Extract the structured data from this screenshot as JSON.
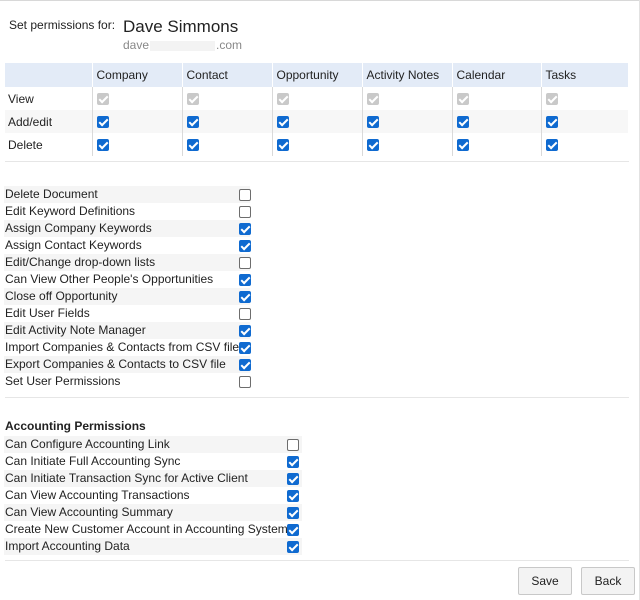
{
  "header": {
    "label": "Set permissions for:",
    "user_name": "Dave Simmons",
    "email_start": "dave",
    "email_end": ".com"
  },
  "object_permissions": {
    "columns": [
      "Company",
      "Contact",
      "Opportunity",
      "Activity Notes",
      "Calendar",
      "Tasks"
    ],
    "rows": [
      {
        "label": "View",
        "state": "disabled-checked",
        "values": [
          true,
          true,
          true,
          true,
          true,
          true
        ]
      },
      {
        "label": "Add/edit",
        "state": "enabled",
        "values": [
          true,
          true,
          true,
          true,
          true,
          true
        ]
      },
      {
        "label": "Delete",
        "state": "enabled",
        "values": [
          true,
          true,
          true,
          true,
          true,
          true
        ]
      }
    ]
  },
  "general_permissions": [
    {
      "label": "Delete Document",
      "checked": false
    },
    {
      "label": "Edit Keyword Definitions",
      "checked": false
    },
    {
      "label": "Assign Company Keywords",
      "checked": true
    },
    {
      "label": "Assign Contact Keywords",
      "checked": true
    },
    {
      "label": "Edit/Change drop-down lists",
      "checked": false
    },
    {
      "label": "Can View Other People's Opportunities",
      "checked": true
    },
    {
      "label": "Close off Opportunity",
      "checked": true
    },
    {
      "label": "Edit User Fields",
      "checked": false
    },
    {
      "label": "Edit Activity Note Manager",
      "checked": true
    },
    {
      "label": "Import Companies & Contacts from CSV file",
      "checked": true
    },
    {
      "label": "Export Companies & Contacts to CSV file",
      "checked": true
    },
    {
      "label": "Set User Permissions",
      "checked": false
    }
  ],
  "accounting": {
    "title": "Accounting Permissions",
    "items": [
      {
        "label": "Can Configure Accounting Link",
        "checked": false
      },
      {
        "label": "Can Initiate Full Accounting Sync",
        "checked": true
      },
      {
        "label": "Can Initiate Transaction Sync for Active Client",
        "checked": true
      },
      {
        "label": "Can View Accounting Transactions",
        "checked": true
      },
      {
        "label": "Can View Accounting Summary",
        "checked": true
      },
      {
        "label": "Create New Customer Account in Accounting System",
        "checked": true
      },
      {
        "label": "Import Accounting Data",
        "checked": true
      }
    ]
  },
  "buttons": {
    "save": "Save",
    "back": "Back"
  },
  "colors": {
    "accent": "#0f6ad0",
    "table_header": "#e3ebf7"
  }
}
